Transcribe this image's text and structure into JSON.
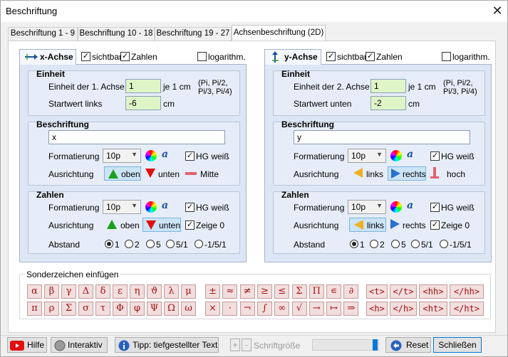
{
  "window": {
    "title": "Beschriftung",
    "close": "✕"
  },
  "tabs": [
    "Beschriftung 1 - 9",
    "Beschriftung 10 - 18",
    "Beschriftung 19 - 27",
    "Achsenbeschriftung (2D)"
  ],
  "x_axis": {
    "title": "x-Achse",
    "visible_label": "sichtbar",
    "numbers_label": "Zahlen",
    "log_label": "logarithm.",
    "visible": true,
    "numbers": true,
    "log": false,
    "unit": {
      "title": "Einheit",
      "unit_label": "Einheit der 1. Achse",
      "unit_value": "1",
      "per_cm": "je 1 cm",
      "hint": "(Pi, Pi/2, Pi/3, Pi/4)",
      "start_label": "Startwert links",
      "start_value": "-6",
      "start_unit": "cm"
    },
    "caption": {
      "title": "Beschriftung",
      "text": "x",
      "format_label": "Formatierung",
      "size": "10p",
      "bg_white": "HG weiß",
      "bg_white_checked": true,
      "align_label": "Ausrichtung",
      "align_options": [
        "oben",
        "unten",
        "Mitte"
      ],
      "align_selected": "oben"
    },
    "numbers_group": {
      "title": "Zahlen",
      "format_label": "Formatierung",
      "size": "10p",
      "bg_white": "HG weiß",
      "bg_white_checked": true,
      "align_label": "Ausrichtung",
      "align_options": [
        "oben",
        "unten"
      ],
      "align_selected": "unten",
      "show_zero": "Zeige 0",
      "show_zero_checked": true,
      "spacing_label": "Abstand",
      "spacing_options": [
        "1",
        "2",
        "5",
        "5/1",
        "-1/5/1"
      ],
      "spacing_selected": "1"
    }
  },
  "y_axis": {
    "title": "y-Achse",
    "visible_label": "sichtbar",
    "numbers_label": "Zahlen",
    "log_label": "logarithm.",
    "visible": true,
    "numbers": true,
    "log": false,
    "unit": {
      "title": "Einheit",
      "unit_label": "Einheit der 2. Achse",
      "unit_value": "1",
      "per_cm": "je 1 cm",
      "hint": "(Pi, Pi/2, Pi/3, Pi/4)",
      "start_label": "Startwert unten",
      "start_value": "-2",
      "start_unit": "cm"
    },
    "caption": {
      "title": "Beschriftung",
      "text": "y",
      "format_label": "Formatierung",
      "size": "10p",
      "bg_white": "HG weiß",
      "bg_white_checked": true,
      "align_label": "Ausrichtung",
      "align_options": [
        "links",
        "rechts",
        "hoch"
      ],
      "align_selected": "rechts"
    },
    "numbers_group": {
      "title": "Zahlen",
      "format_label": "Formatierung",
      "size": "10p",
      "bg_white": "HG weiß",
      "bg_white_checked": true,
      "align_label": "Ausrichtung",
      "align_options": [
        "links",
        "rechts"
      ],
      "align_selected": "links",
      "show_zero": "Zeige 0",
      "show_zero_checked": true,
      "spacing_label": "Abstand",
      "spacing_options": [
        "1",
        "2",
        "5",
        "5/1",
        "-1/5/1"
      ],
      "spacing_selected": "1"
    }
  },
  "special": {
    "title": "Sonderzeichen einfügen",
    "greek_row1": [
      "α",
      "β",
      "γ",
      "Δ",
      "δ",
      "ε",
      "η",
      "ϑ",
      "λ",
      "μ"
    ],
    "greek_row2": [
      "π",
      "ρ",
      "Σ",
      "σ",
      "τ",
      "Φ",
      "φ",
      "Ψ",
      "Ω",
      "ω"
    ],
    "math_row1": [
      "±",
      "≈",
      "≠",
      "≥",
      "≤",
      "Σ",
      "Π",
      "∊",
      "∂"
    ],
    "math_row2": [
      "×",
      "·",
      "¬",
      "∫",
      "∞",
      "√",
      "→",
      "↦",
      "⇒"
    ],
    "tag_row1": [
      "<t>",
      "</t>",
      "<hh>",
      "</hh>"
    ],
    "tag_row2": [
      "<h>",
      "</h>",
      "<ht>",
      "</ht>"
    ]
  },
  "bottom": {
    "help": "Hilfe",
    "interactive": "Interaktiv",
    "tip": "Tipp: tiefgestellter Text",
    "plus": "+",
    "minus": "-",
    "font_size": "Schriftgröße",
    "reset": "Reset",
    "close": "Schließen"
  },
  "colors": {
    "accent_green": "#dff5c8",
    "panel_blue": "#dde6f5",
    "symbol_red": "#a01010",
    "triangle_green": "#1aa01a",
    "triangle_red": "#e01010"
  }
}
